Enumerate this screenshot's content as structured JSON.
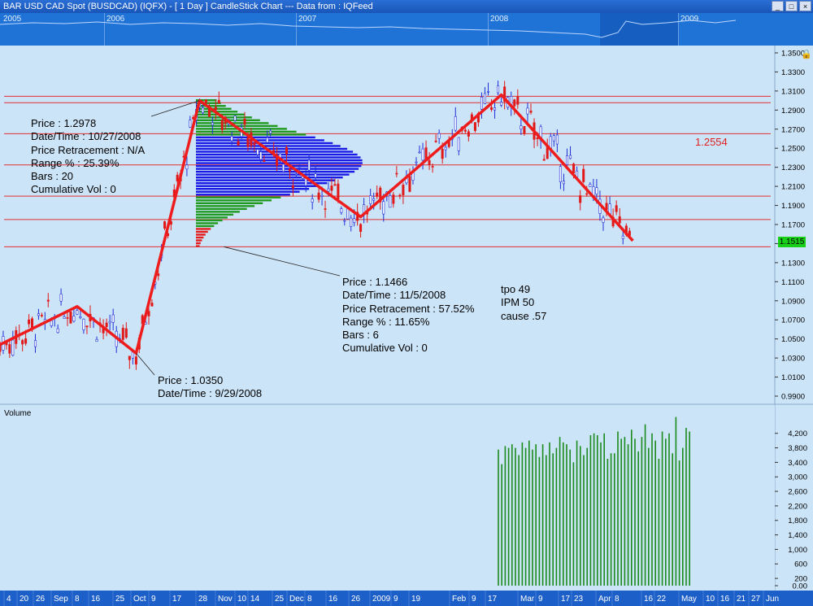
{
  "window": {
    "title": "BAR USD CAD Spot (BUSDCAD) (IQFX) -  [ 1 Day ] CandleStick Chart --- Data from : IQFeed",
    "buttons": [
      "_",
      "□",
      "×"
    ]
  },
  "overview": {
    "years": [
      "2005",
      "2006",
      "2007",
      "2008",
      "2009"
    ]
  },
  "labels": {
    "level_price": "1.2554",
    "current_price": "1.1515",
    "volume_title": "Volume"
  },
  "annotations": {
    "top": [
      "Price : 1.2978",
      "Date/Time : 10/27/2008",
      "Price Retracement : N/A",
      "Range % : 25.39%",
      "Bars : 20",
      "Cumulative Vol : 0"
    ],
    "middle": [
      "Price : 1.1466",
      "Date/Time : 11/5/2008",
      "Price Retracement : 57.52%",
      "Range % : 11.65%",
      "Bars : 6",
      "Cumulative Vol : 0"
    ],
    "bottom": [
      "Price : 1.0350",
      "Date/Time : 9/29/2008"
    ],
    "notes": [
      "tpo 49",
      "IPM 50",
      "cause .57"
    ]
  },
  "colors": {
    "background": "#cce4f7",
    "zigzag": "#ee1c1c",
    "profile_blue": "#1a1ae6",
    "profile_green": "#1f9a1f",
    "profile_red": "#e61c1c",
    "volume": "#1a8a1a",
    "hline": "#e03030"
  },
  "chart_data": [
    {
      "type": "line",
      "title": "",
      "yaxis_ticks": [
        "1.3500",
        "1.3300",
        "1.3100",
        "1.2900",
        "1.2700",
        "1.2500",
        "1.2300",
        "1.2100",
        "1.1900",
        "1.1700",
        "1.1500",
        "1.1300",
        "1.1100",
        "1.0900",
        "1.0700",
        "1.0500",
        "1.0300",
        "1.0100",
        "0.9900"
      ],
      "ylim": [
        0.975,
        1.358
      ],
      "xaxis_ticks": [
        "4",
        "20",
        "26",
        "Sep",
        "8",
        "16",
        "25",
        "Oct",
        "9",
        "17",
        "28",
        "Nov",
        "10",
        "14",
        "25",
        "Dec",
        "8",
        "16",
        "26",
        "2009",
        "9",
        "19",
        "Feb",
        "9",
        "17",
        "Mar",
        "9",
        "17",
        "23",
        "Apr",
        "8",
        "16",
        "22",
        "May",
        "10",
        "16",
        "21",
        "27",
        "Jun"
      ],
      "horizontal_levels": [
        1.3045,
        1.2978,
        1.2652,
        1.2325,
        1.1998,
        1.1752,
        1.1466
      ],
      "zigzag": [
        {
          "date": "2008-07-31",
          "price": 1.044
        },
        {
          "date": "2008-09-03",
          "price": 1.084
        },
        {
          "date": "2008-09-29",
          "price": 1.035
        },
        {
          "date": "2008-10-27",
          "price": 1.3
        },
        {
          "date": "2009-01-06",
          "price": 1.178
        },
        {
          "date": "2009-03-09",
          "price": 1.306
        },
        {
          "date": "2009-05-06",
          "price": 1.153
        }
      ],
      "last_price": 1.1515,
      "marked_level": 1.2554
    },
    {
      "type": "bar",
      "title": "Volume",
      "yaxis_ticks": [
        "4,200",
        "3,800",
        "3,400",
        "3,000",
        "2,600",
        "2,200",
        "1,800",
        "1,400",
        "1,000",
        "600",
        "200",
        "0.00"
      ],
      "ylim": [
        0,
        4620
      ],
      "values": [
        3750,
        3350,
        3850,
        3800,
        3900,
        3800,
        3600,
        3950,
        3800,
        4000,
        3750,
        3900,
        3550,
        3900,
        3600,
        3950,
        3650,
        3800,
        4100,
        3950,
        3900,
        3750,
        3400,
        4000,
        3850,
        3600,
        3800,
        4150,
        4200,
        4150,
        3950,
        4200,
        3500,
        3650,
        3650,
        4250,
        4050,
        4100,
        3900,
        4300,
        4050,
        3700,
        4100,
        4450,
        3800,
        4200,
        4000,
        3500,
        4250,
        4050,
        4200,
        3650,
        4650,
        3450,
        3800,
        4350,
        4250
      ]
    }
  ]
}
